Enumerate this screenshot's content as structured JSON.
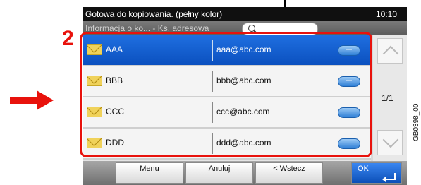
{
  "status_bar": {
    "message": "Gotowa do kopiowania. (pełny kolor)",
    "time": "10:10"
  },
  "info_bar": {
    "breadcrumb": "Informacja o ko... - Ks. adresowa"
  },
  "contacts": [
    {
      "name": "AAA",
      "email": "aaa@abc.com",
      "selected": true
    },
    {
      "name": "BBB",
      "email": "bbb@abc.com",
      "selected": false
    },
    {
      "name": "CCC",
      "email": "ccc@abc.com",
      "selected": false
    },
    {
      "name": "DDD",
      "email": "ddd@abc.com",
      "selected": false
    }
  ],
  "pagination": {
    "page": "1/1"
  },
  "buttons": {
    "menu": "Menu",
    "cancel": "Anuluj",
    "back": "< Wstecz",
    "ok": "OK"
  },
  "annotations": {
    "step_number": "2",
    "figure_code": "GB0398_00"
  },
  "colors": {
    "callout": "#e8120c",
    "selected_row": "#1f6fe0",
    "ok_button": "#1d6ad8"
  },
  "icons": {
    "contact": "envelope-icon",
    "detail": "detail-icon",
    "search": "search-icon"
  }
}
